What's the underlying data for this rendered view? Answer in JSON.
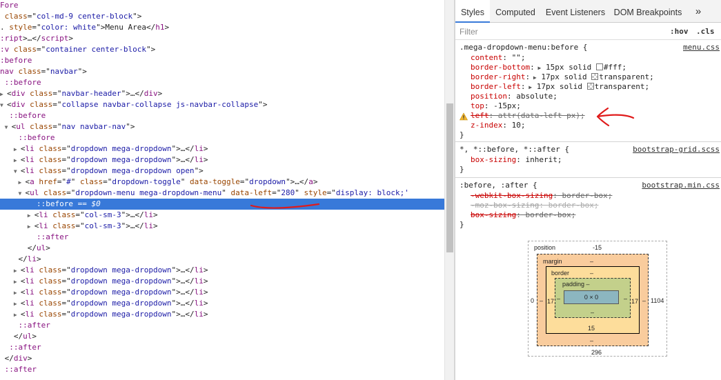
{
  "dom": {
    "lines": [
      {
        "tri": "",
        "parts": [
          [
            "tag",
            "Fore"
          ]
        ]
      },
      {
        "tri": "",
        "parts": [
          [
            "attr",
            " class"
          ],
          [
            "txt",
            "=\""
          ],
          [
            "val",
            "col-md-9 center-block"
          ],
          [
            "txt",
            "\">"
          ]
        ]
      },
      {
        "tri": "",
        "parts": [
          [
            "txt",
            ". "
          ],
          [
            "attr",
            "style"
          ],
          [
            "txt",
            "=\""
          ],
          [
            "val",
            "color: white"
          ],
          [
            "txt",
            "\">Menu Area</"
          ],
          [
            "tag",
            "h1"
          ],
          [
            "txt",
            ">"
          ]
        ]
      },
      {
        "tri": "",
        "parts": [
          [
            "tag",
            ":ript"
          ],
          [
            "txt",
            ">…</"
          ],
          [
            "tag",
            "script"
          ],
          [
            "txt",
            ">"
          ]
        ]
      },
      {
        "tri": "",
        "parts": [
          [
            "tag",
            ":v"
          ],
          [
            "attr",
            " class"
          ],
          [
            "txt",
            "=\""
          ],
          [
            "val",
            "container center-block"
          ],
          [
            "txt",
            "\">"
          ]
        ]
      },
      {
        "tri": "",
        "parts": [
          [
            "pseudo",
            ":before"
          ]
        ]
      },
      {
        "tri": "",
        "parts": [
          [
            "tag",
            "nav"
          ],
          [
            "attr",
            " class"
          ],
          [
            "txt",
            "=\""
          ],
          [
            "val",
            "navbar"
          ],
          [
            "txt",
            "\">"
          ]
        ]
      },
      {
        "tri": "",
        "parts": [
          [
            "pseudo",
            " ::before"
          ]
        ]
      },
      {
        "tri": "▶",
        "parts": [
          [
            "txt",
            "<"
          ],
          [
            "tag",
            "div"
          ],
          [
            "attr",
            " class"
          ],
          [
            "txt",
            "=\""
          ],
          [
            "val",
            "navbar-header"
          ],
          [
            "txt",
            "\">…</"
          ],
          [
            "tag",
            "div"
          ],
          [
            "txt",
            ">"
          ]
        ]
      },
      {
        "tri": "▼",
        "parts": [
          [
            "txt",
            "<"
          ],
          [
            "tag",
            "div"
          ],
          [
            "attr",
            " class"
          ],
          [
            "txt",
            "=\""
          ],
          [
            "val",
            "collapse navbar-collapse js-navbar-collapse"
          ],
          [
            "txt",
            "\">"
          ]
        ]
      },
      {
        "tri": "",
        "parts": [
          [
            "pseudo",
            "  ::before"
          ]
        ]
      },
      {
        "tri": " ▼",
        "parts": [
          [
            "txt",
            "<"
          ],
          [
            "tag",
            "ul"
          ],
          [
            "attr",
            " class"
          ],
          [
            "txt",
            "=\""
          ],
          [
            "val",
            "nav navbar-nav"
          ],
          [
            "txt",
            "\">"
          ]
        ]
      },
      {
        "tri": "",
        "parts": [
          [
            "pseudo",
            "    ::before"
          ]
        ]
      },
      {
        "tri": "   ▶",
        "parts": [
          [
            "txt",
            "<"
          ],
          [
            "tag",
            "li"
          ],
          [
            "attr",
            " class"
          ],
          [
            "txt",
            "=\""
          ],
          [
            "val",
            "dropdown mega-dropdown"
          ],
          [
            "txt",
            "\">…</"
          ],
          [
            "tag",
            "li"
          ],
          [
            "txt",
            ">"
          ]
        ]
      },
      {
        "tri": "   ▶",
        "parts": [
          [
            "txt",
            "<"
          ],
          [
            "tag",
            "li"
          ],
          [
            "attr",
            " class"
          ],
          [
            "txt",
            "=\""
          ],
          [
            "val",
            "dropdown mega-dropdown"
          ],
          [
            "txt",
            "\">…</"
          ],
          [
            "tag",
            "li"
          ],
          [
            "txt",
            ">"
          ]
        ]
      },
      {
        "tri": "   ▼",
        "parts": [
          [
            "txt",
            "<"
          ],
          [
            "tag",
            "li"
          ],
          [
            "attr",
            " class"
          ],
          [
            "txt",
            "=\""
          ],
          [
            "val",
            "dropdown mega-dropdown open"
          ],
          [
            "txt",
            "\">"
          ]
        ]
      },
      {
        "tri": "    ▶",
        "parts": [
          [
            "txt",
            "<"
          ],
          [
            "tag",
            "a"
          ],
          [
            "attr",
            " href"
          ],
          [
            "txt",
            "=\""
          ],
          [
            "val",
            "#"
          ],
          [
            "txt",
            "\""
          ],
          [
            "attr",
            " class"
          ],
          [
            "txt",
            "=\""
          ],
          [
            "val",
            "dropdown-toggle"
          ],
          [
            "txt",
            "\""
          ],
          [
            "attr",
            " data-toggle"
          ],
          [
            "txt",
            "=\""
          ],
          [
            "val",
            "dropdown"
          ],
          [
            "txt",
            "\">…</"
          ],
          [
            "tag",
            "a"
          ],
          [
            "txt",
            ">"
          ]
        ]
      },
      {
        "tri": "    ▼",
        "parts": [
          [
            "txt",
            "<"
          ],
          [
            "tag",
            "ul"
          ],
          [
            "attr",
            " class"
          ],
          [
            "txt",
            "=\""
          ],
          [
            "val",
            "dropdown-menu mega-dropdown-menu"
          ],
          [
            "txt",
            "\" "
          ],
          [
            "attr",
            "data-left"
          ],
          [
            "txt",
            "=\""
          ],
          [
            "val",
            "280"
          ],
          [
            "txt",
            "\" "
          ],
          [
            "attr",
            "style"
          ],
          [
            "txt",
            "=\""
          ],
          [
            "val",
            "display: block;'"
          ]
        ]
      },
      {
        "tri": "",
        "parts": [
          [
            "pseudo",
            "        ::before"
          ],
          [
            "eq",
            " == $0"
          ]
        ],
        "selected": true
      },
      {
        "tri": "      ▶",
        "parts": [
          [
            "txt",
            "<"
          ],
          [
            "tag",
            "li"
          ],
          [
            "attr",
            " class"
          ],
          [
            "txt",
            "=\""
          ],
          [
            "val",
            "col-sm-3"
          ],
          [
            "txt",
            "\">…</"
          ],
          [
            "tag",
            "li"
          ],
          [
            "txt",
            ">"
          ]
        ]
      },
      {
        "tri": "      ▶",
        "parts": [
          [
            "txt",
            "<"
          ],
          [
            "tag",
            "li"
          ],
          [
            "attr",
            " class"
          ],
          [
            "txt",
            "=\""
          ],
          [
            "val",
            "col-sm-3"
          ],
          [
            "txt",
            "\">…</"
          ],
          [
            "tag",
            "li"
          ],
          [
            "txt",
            ">"
          ]
        ]
      },
      {
        "tri": "",
        "parts": [
          [
            "pseudo",
            "        ::after"
          ]
        ]
      },
      {
        "tri": "",
        "parts": [
          [
            "txt",
            "      </"
          ],
          [
            "tag",
            "ul"
          ],
          [
            "txt",
            ">"
          ]
        ]
      },
      {
        "tri": "",
        "parts": [
          [
            "txt",
            "    </"
          ],
          [
            "tag",
            "li"
          ],
          [
            "txt",
            ">"
          ]
        ]
      },
      {
        "tri": "   ▶",
        "parts": [
          [
            "txt",
            "<"
          ],
          [
            "tag",
            "li"
          ],
          [
            "attr",
            " class"
          ],
          [
            "txt",
            "=\""
          ],
          [
            "val",
            "dropdown mega-dropdown"
          ],
          [
            "txt",
            "\">…</"
          ],
          [
            "tag",
            "li"
          ],
          [
            "txt",
            ">"
          ]
        ]
      },
      {
        "tri": "   ▶",
        "parts": [
          [
            "txt",
            "<"
          ],
          [
            "tag",
            "li"
          ],
          [
            "attr",
            " class"
          ],
          [
            "txt",
            "=\""
          ],
          [
            "val",
            "dropdown mega-dropdown"
          ],
          [
            "txt",
            "\">…</"
          ],
          [
            "tag",
            "li"
          ],
          [
            "txt",
            ">"
          ]
        ]
      },
      {
        "tri": "   ▶",
        "parts": [
          [
            "txt",
            "<"
          ],
          [
            "tag",
            "li"
          ],
          [
            "attr",
            " class"
          ],
          [
            "txt",
            "=\""
          ],
          [
            "val",
            "dropdown mega-dropdown"
          ],
          [
            "txt",
            "\">…</"
          ],
          [
            "tag",
            "li"
          ],
          [
            "txt",
            ">"
          ]
        ]
      },
      {
        "tri": "   ▶",
        "parts": [
          [
            "txt",
            "<"
          ],
          [
            "tag",
            "li"
          ],
          [
            "attr",
            " class"
          ],
          [
            "txt",
            "=\""
          ],
          [
            "val",
            "dropdown mega-dropdown"
          ],
          [
            "txt",
            "\">…</"
          ],
          [
            "tag",
            "li"
          ],
          [
            "txt",
            ">"
          ]
        ]
      },
      {
        "tri": "   ▶",
        "parts": [
          [
            "txt",
            "<"
          ],
          [
            "tag",
            "li"
          ],
          [
            "attr",
            " class"
          ],
          [
            "txt",
            "=\""
          ],
          [
            "val",
            "dropdown mega-dropdown"
          ],
          [
            "txt",
            "\">…</"
          ],
          [
            "tag",
            "li"
          ],
          [
            "txt",
            ">"
          ]
        ]
      },
      {
        "tri": "",
        "parts": [
          [
            "pseudo",
            "    ::after"
          ]
        ]
      },
      {
        "tri": "",
        "parts": [
          [
            "txt",
            "   </"
          ],
          [
            "tag",
            "ul"
          ],
          [
            "txt",
            ">"
          ]
        ]
      },
      {
        "tri": "",
        "parts": [
          [
            "pseudo",
            "  ::after"
          ]
        ]
      },
      {
        "tri": "",
        "parts": [
          [
            "txt",
            " </"
          ],
          [
            "tag",
            "div"
          ],
          [
            "txt",
            ">"
          ]
        ]
      },
      {
        "tri": "",
        "parts": [
          [
            "pseudo",
            " ::after"
          ]
        ]
      }
    ]
  },
  "sidebar": {
    "tabs": [
      "Styles",
      "Computed",
      "Event Listeners",
      "DOM Breakpoints",
      "»"
    ],
    "filter_placeholder": "Filter",
    "hov_label": ":hov",
    "cls_label": ".cls"
  },
  "styles": {
    "rule1": {
      "selector": ".mega-dropdown-menu:before {",
      "source": "menu.css",
      "decls": [
        {
          "name": "content",
          "value": " \"\";"
        },
        {
          "name": "border-bottom",
          "value": " 15px solid ",
          "swatch": "white",
          "tail": "#fff;"
        },
        {
          "name": "border-right",
          "value": " 17px solid ",
          "swatch": "transparent",
          "tail": "transparent;"
        },
        {
          "name": "border-left",
          "value": " 17px solid ",
          "swatch": "transparent",
          "tail": "transparent;"
        },
        {
          "name": "position",
          "value": " absolute;"
        },
        {
          "name": "top",
          "value": " -15px;"
        },
        {
          "name": "left",
          "value": " attr(data-left px);",
          "overridden": true,
          "warning": true
        },
        {
          "name": "z-index",
          "value": " 10;"
        }
      ],
      "close": "}"
    },
    "rule2": {
      "selector": "*, *::before, *::after {",
      "source": "bootstrap-grid.scss",
      "decls": [
        {
          "name": "box-sizing",
          "value": " inherit;"
        }
      ],
      "close": "}"
    },
    "rule3": {
      "selector": ":before, :after {",
      "source": "bootstrap.min.css",
      "decls": [
        {
          "name": "-webkit-box-sizing",
          "value": " border-box;",
          "overridden": true
        },
        {
          "name": "-moz-box-sizing",
          "value": " border-box;",
          "overridden": true,
          "dim": true
        },
        {
          "name": "box-sizing",
          "value": " border-box;",
          "overridden": true
        }
      ],
      "close": "}"
    }
  },
  "box_model": {
    "position_label": "position",
    "position_top": "-15",
    "position_left": "0",
    "position_right": "1104",
    "position_bottom": "296",
    "margin_label": "margin",
    "margin_top": "–",
    "margin_bottom": "–",
    "margin_left": "–",
    "margin_right": "–",
    "border_label": "border",
    "border_top": "–",
    "border_bottom": "15",
    "border_left": "17",
    "border_right": "17",
    "padding_label": "padding –",
    "padding_bottom": "–",
    "padding_left": "–",
    "padding_right": "–",
    "content_size": "0 × 0"
  }
}
